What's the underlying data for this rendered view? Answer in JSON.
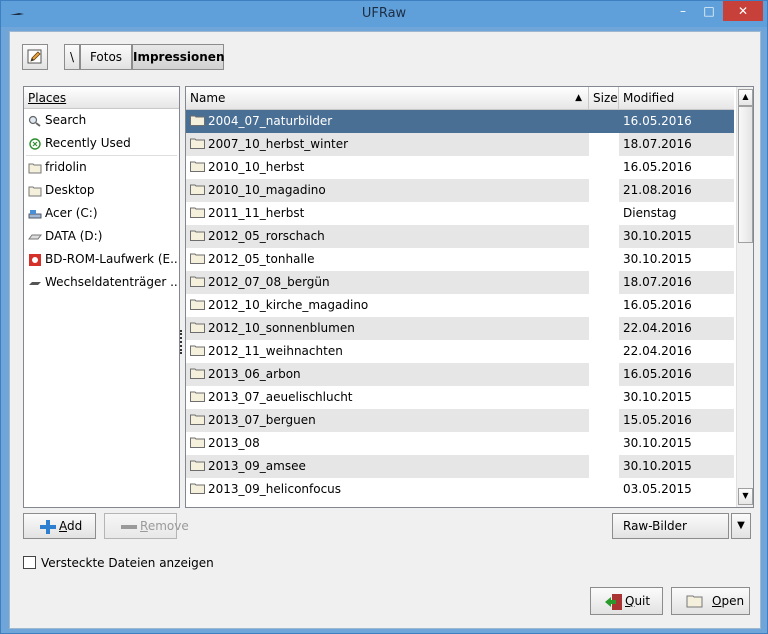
{
  "window": {
    "title": "UFRaw",
    "minimize_glyph": "–",
    "maximize_glyph": "□",
    "close_glyph": "✕"
  },
  "pathbar": {
    "root": "\\",
    "segments": [
      "Fotos",
      "Impressionen"
    ]
  },
  "places": {
    "header": "Places",
    "items": [
      {
        "label": "Search",
        "icon": "search-icon"
      },
      {
        "label": "Recently Used",
        "icon": "recent-icon"
      },
      {
        "label": "fridolin",
        "icon": "folder-icon"
      },
      {
        "label": "Desktop",
        "icon": "folder-icon"
      },
      {
        "label": "Acer (C:)",
        "icon": "drive-icon"
      },
      {
        "label": "DATA (D:)",
        "icon": "drive-icon"
      },
      {
        "label": "BD-ROM-Laufwerk (E...",
        "icon": "optical-drive-icon"
      },
      {
        "label": "Wechseldatenträger ...",
        "icon": "removable-drive-icon"
      }
    ]
  },
  "files": {
    "columns": {
      "name": "Name",
      "size": "Size",
      "modified": "Modified"
    },
    "sort_indicator": "▲",
    "rows": [
      {
        "name": "2004_07_naturbilder",
        "size": "",
        "modified": "16.05.2016"
      },
      {
        "name": "2007_10_herbst_winter",
        "size": "",
        "modified": "18.07.2016"
      },
      {
        "name": "2010_10_herbst",
        "size": "",
        "modified": "16.05.2016"
      },
      {
        "name": "2010_10_magadino",
        "size": "",
        "modified": "21.08.2016"
      },
      {
        "name": "2011_11_herbst",
        "size": "",
        "modified": "Dienstag"
      },
      {
        "name": "2012_05_rorschach",
        "size": "",
        "modified": "30.10.2015"
      },
      {
        "name": "2012_05_tonhalle",
        "size": "",
        "modified": "30.10.2015"
      },
      {
        "name": "2012_07_08_bergün",
        "size": "",
        "modified": "18.07.2016"
      },
      {
        "name": "2012_10_kirche_magadino",
        "size": "",
        "modified": "16.05.2016"
      },
      {
        "name": "2012_10_sonnenblumen",
        "size": "",
        "modified": "22.04.2016"
      },
      {
        "name": "2012_11_weihnachten",
        "size": "",
        "modified": "22.04.2016"
      },
      {
        "name": "2013_06_arbon",
        "size": "",
        "modified": "16.05.2016"
      },
      {
        "name": "2013_07_aeuelischlucht",
        "size": "",
        "modified": "30.10.2015"
      },
      {
        "name": "2013_07_berguen",
        "size": "",
        "modified": "15.05.2016"
      },
      {
        "name": "2013_08",
        "size": "",
        "modified": "30.10.2015"
      },
      {
        "name": "2013_09_amsee",
        "size": "",
        "modified": "30.10.2015"
      },
      {
        "name": "2013_09_heliconfocus",
        "size": "",
        "modified": "03.05.2015"
      }
    ],
    "selected_index": 0
  },
  "buttons": {
    "add_u": "A",
    "add_rest": "dd",
    "remove_u": "R",
    "remove_rest": "emove",
    "quit_u": "Q",
    "quit_rest": "uit",
    "open_u": "O",
    "open_rest": "pen"
  },
  "filter": {
    "value": "Raw-Bilder",
    "arrow": "▼"
  },
  "hidden_files_label": "Versteckte Dateien anzeigen",
  "colors": {
    "selection": "#4a6f95",
    "close_button": "#c7403a",
    "titlebar": "#5fa0da"
  }
}
